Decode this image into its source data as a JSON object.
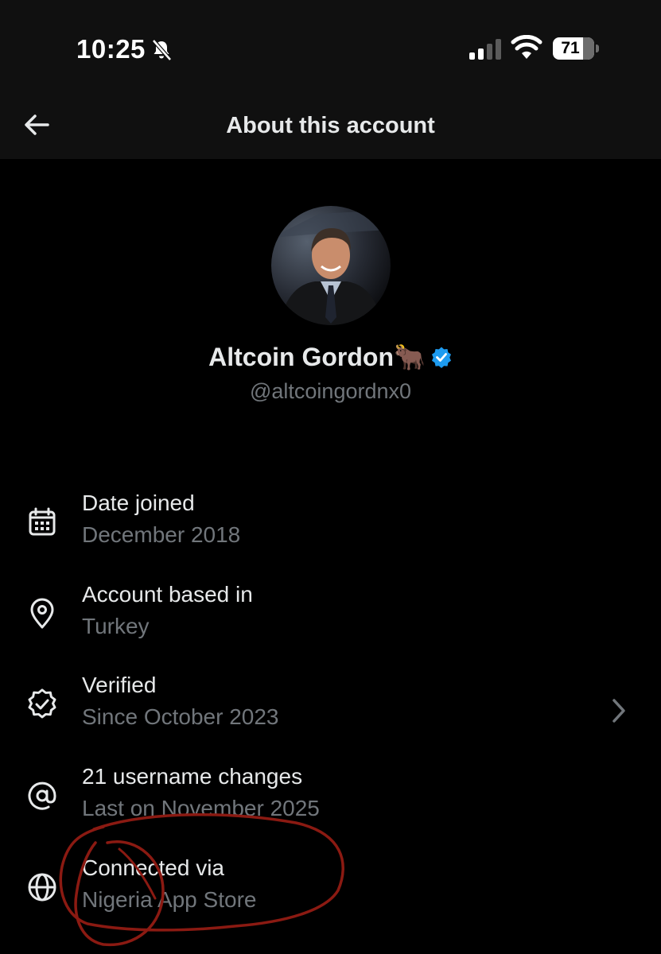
{
  "status_bar": {
    "time": "10:25",
    "battery": "71",
    "icons": [
      "bell-slash-icon",
      "cellular-signal-icon",
      "wifi-icon",
      "battery-icon"
    ]
  },
  "header": {
    "title": "About this account",
    "back_icon": "arrow-left-icon"
  },
  "profile": {
    "name": "Altcoin Gordon🐂",
    "handle": "@altcoingordnx0",
    "verified_badge_color": "#1d9bf0"
  },
  "details": [
    {
      "icon": "calendar-icon",
      "title": "Date joined",
      "subtitle": "December 2018"
    },
    {
      "icon": "location-pin-icon",
      "title": "Account based in",
      "subtitle": "Turkey"
    },
    {
      "icon": "verified-check-icon",
      "title": "Verified",
      "subtitle": "Since October 2023"
    },
    {
      "icon": "at-sign-icon",
      "title": "21 username changes",
      "subtitle": "Last on November 2025"
    },
    {
      "icon": "globe-icon",
      "title": "Connected via",
      "subtitle": "Nigeria App Store"
    }
  ],
  "colors": {
    "background": "#000000",
    "header_background": "#101010",
    "primary_text": "#e7e9ea",
    "secondary_text": "#71767b",
    "verified_blue": "#1d9bf0",
    "annotation_red": "#8b1a12"
  }
}
